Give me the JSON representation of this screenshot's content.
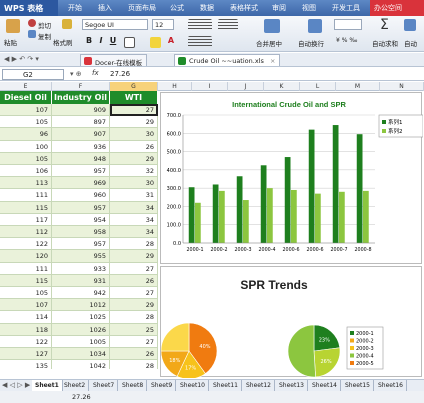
{
  "app": {
    "logo": "WPS 表格"
  },
  "menu": [
    "开始",
    "插入",
    "页面布局",
    "公式",
    "数据",
    "表格样式",
    "审阅",
    "视图",
    "开发工具"
  ],
  "win_badge": "办公空间",
  "toolbar": {
    "paste": "粘贴",
    "cut": "剪切",
    "copy": "复制",
    "format_painter": "格式刷",
    "font_name": "Segoe UI",
    "font_size": "12",
    "merge_center": "合并居中",
    "wrap_text": "自动换行",
    "autosum": "自动求和",
    "autofilter": "自动"
  },
  "doc_tabs": [
    "Docer-在线模板",
    "Crude Oil ~~uation.xls"
  ],
  "formula_bar": {
    "cell_ref": "G2",
    "fx": "fx",
    "value": "27.26"
  },
  "columns": [
    "E",
    "F",
    "G",
    "H",
    "I",
    "J",
    "K",
    "L",
    "M",
    "N"
  ],
  "grid": {
    "headers": [
      "Diesel Oil",
      "Industry Oil",
      "WTI"
    ],
    "rows": [
      [
        "107",
        "909",
        "27"
      ],
      [
        "105",
        "897",
        "29"
      ],
      [
        "96",
        "907",
        "30"
      ],
      [
        "100",
        "936",
        "26"
      ],
      [
        "105",
        "948",
        "29"
      ],
      [
        "106",
        "957",
        "32"
      ],
      [
        "113",
        "969",
        "30"
      ],
      [
        "111",
        "960",
        "31"
      ],
      [
        "115",
        "957",
        "34"
      ],
      [
        "117",
        "954",
        "34"
      ],
      [
        "112",
        "958",
        "34"
      ],
      [
        "122",
        "957",
        "28"
      ],
      [
        "120",
        "955",
        "29"
      ],
      [
        "111",
        "933",
        "27"
      ],
      [
        "115",
        "931",
        "26"
      ],
      [
        "105",
        "942",
        "27"
      ],
      [
        "107",
        "1012",
        "29"
      ],
      [
        "114",
        "1025",
        "28"
      ],
      [
        "118",
        "1026",
        "25"
      ],
      [
        "122",
        "1005",
        "27"
      ],
      [
        "127",
        "1034",
        "26"
      ],
      [
        "135",
        "1042",
        "28"
      ]
    ]
  },
  "chart1": {
    "title": "International Crude Oil and SPR",
    "legend": [
      "系列1",
      "系列2"
    ],
    "y_ticks": [
      "0.0",
      "100.0",
      "200.0",
      "300.0",
      "400.0",
      "500.0",
      "600.0",
      "700.0"
    ],
    "colors": {
      "series1": "#1e7f1e",
      "series2": "#8cc63f"
    }
  },
  "chart2": {
    "title": "SPR Trends",
    "legend": [
      "2000-1",
      "2000-2",
      "2000-3",
      "2000-4",
      "2000-5"
    ],
    "pie1": {
      "labels": [
        "40%",
        "17%",
        "18%"
      ]
    },
    "pie2": {
      "labels": [
        "23%",
        "26%"
      ]
    }
  },
  "chart_data": [
    {
      "type": "bar",
      "title": "International Crude Oil and SPR",
      "categories": [
        "2000-1",
        "2000-2",
        "2000-3",
        "2000-4",
        "2000-6",
        "2000-6",
        "2000-7",
        "2000-8"
      ],
      "ylim": [
        0,
        700
      ],
      "series": [
        {
          "name": "系列1",
          "values": [
            305,
            320,
            365,
            425,
            470,
            620,
            645,
            595
          ]
        },
        {
          "name": "系列2",
          "values": [
            220,
            285,
            235,
            300,
            290,
            270,
            280,
            285
          ]
        }
      ],
      "legend": "right",
      "grid": true
    },
    {
      "type": "pie",
      "title": "SPR Trends",
      "series": [
        {
          "values": [
            40,
            17,
            18,
            25
          ],
          "labels": [
            "40%",
            "17%",
            "18%",
            ""
          ]
        },
        {
          "values": [
            23,
            26,
            51
          ],
          "labels": [
            "23%",
            "26%",
            ""
          ]
        }
      ]
    }
  ],
  "sheets": [
    "Sheet1",
    "Sheet2",
    "Sheet7",
    "Sheet8",
    "Sheet9",
    "Sheet10",
    "Sheet11",
    "Sheet12",
    "Sheet13",
    "Sheet14",
    "Sheet15",
    "Sheet16"
  ],
  "status": {
    "value": "27.26"
  }
}
